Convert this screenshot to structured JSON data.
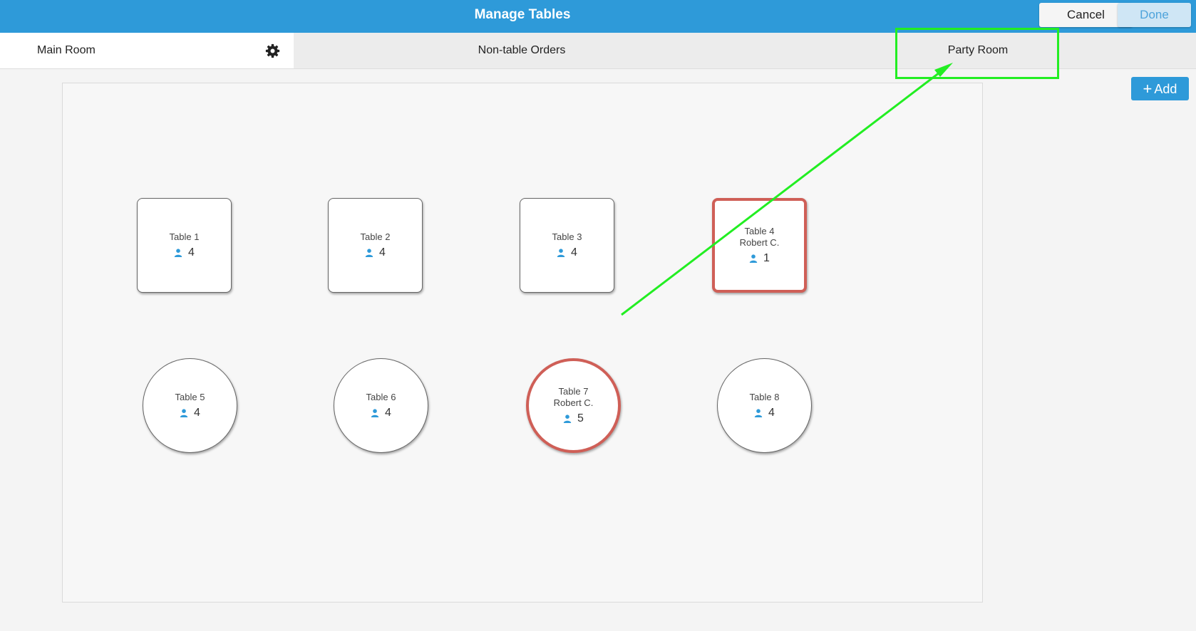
{
  "header": {
    "title": "Manage Tables",
    "cancel_label": "Cancel",
    "done_label": "Done"
  },
  "rooms": {
    "main": "Main Room",
    "non_table": "Non-table Orders",
    "party": "Party Room"
  },
  "toolbar": {
    "add_label": "Add"
  },
  "tables": [
    {
      "name": "Table 1",
      "server": "",
      "seats": "4"
    },
    {
      "name": "Table 2",
      "server": "",
      "seats": "4"
    },
    {
      "name": "Table 3",
      "server": "",
      "seats": "4"
    },
    {
      "name": "Table 4",
      "server": "Robert C.",
      "seats": "1"
    },
    {
      "name": "Table 5",
      "server": "",
      "seats": "4"
    },
    {
      "name": "Table 6",
      "server": "",
      "seats": "4"
    },
    {
      "name": "Table 7",
      "server": "Robert C.",
      "seats": "5"
    },
    {
      "name": "Table 8",
      "server": "",
      "seats": "4"
    }
  ],
  "colors": {
    "accent": "#2e9ad9",
    "occupied": "#cf5f57",
    "annotation": "#22ee22"
  },
  "icons": {
    "settings": "gear-icon",
    "seats": "person-icon",
    "add": "plus-icon"
  }
}
